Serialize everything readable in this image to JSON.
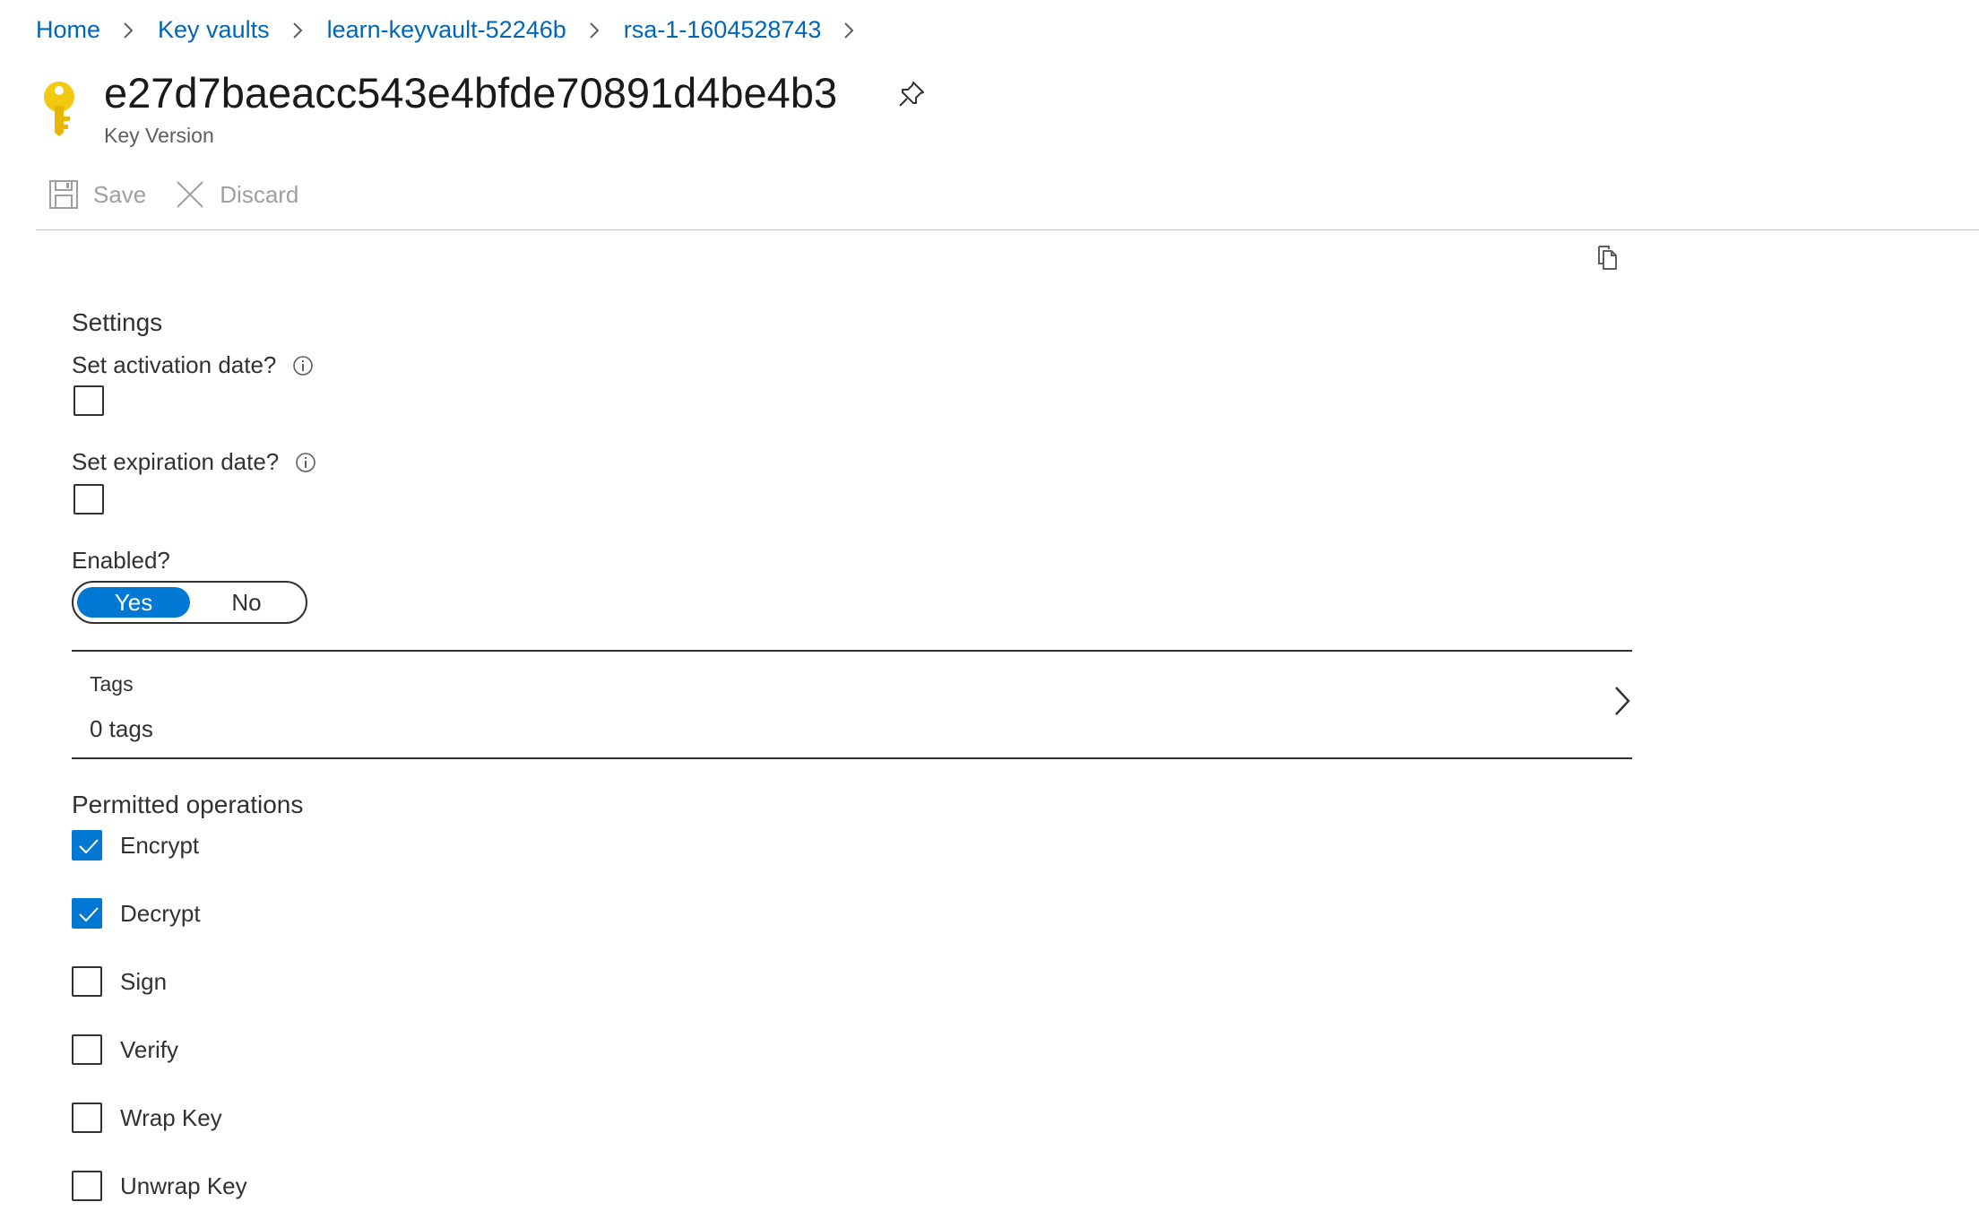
{
  "breadcrumb": {
    "items": [
      {
        "label": "Home"
      },
      {
        "label": "Key vaults"
      },
      {
        "label": "learn-keyvault-52246b"
      },
      {
        "label": "rsa-1-1604528743"
      }
    ]
  },
  "header": {
    "title": "e27d7baeacc543e4bfde70891d4be4b3",
    "subtitle": "Key Version",
    "icon": "key-icon",
    "icon_color": "#f2c811"
  },
  "toolbar": {
    "save_label": "Save",
    "discard_label": "Discard"
  },
  "settings": {
    "heading": "Settings",
    "activation": {
      "label": "Set activation date?",
      "checked": false
    },
    "expiration": {
      "label": "Set expiration date?",
      "checked": false
    },
    "enabled": {
      "label": "Enabled?",
      "options": [
        "Yes",
        "No"
      ],
      "selected": "Yes"
    }
  },
  "tags": {
    "label": "Tags",
    "value": "0 tags"
  },
  "permitted_operations": {
    "heading": "Permitted operations",
    "items": [
      {
        "label": "Encrypt",
        "checked": true
      },
      {
        "label": "Decrypt",
        "checked": true
      },
      {
        "label": "Sign",
        "checked": false
      },
      {
        "label": "Verify",
        "checked": false
      },
      {
        "label": "Wrap Key",
        "checked": false
      },
      {
        "label": "Unwrap Key",
        "checked": false
      }
    ]
  },
  "colors": {
    "accent": "#0078d4",
    "link": "#0067b8",
    "disabled_text": "#a19f9d"
  }
}
